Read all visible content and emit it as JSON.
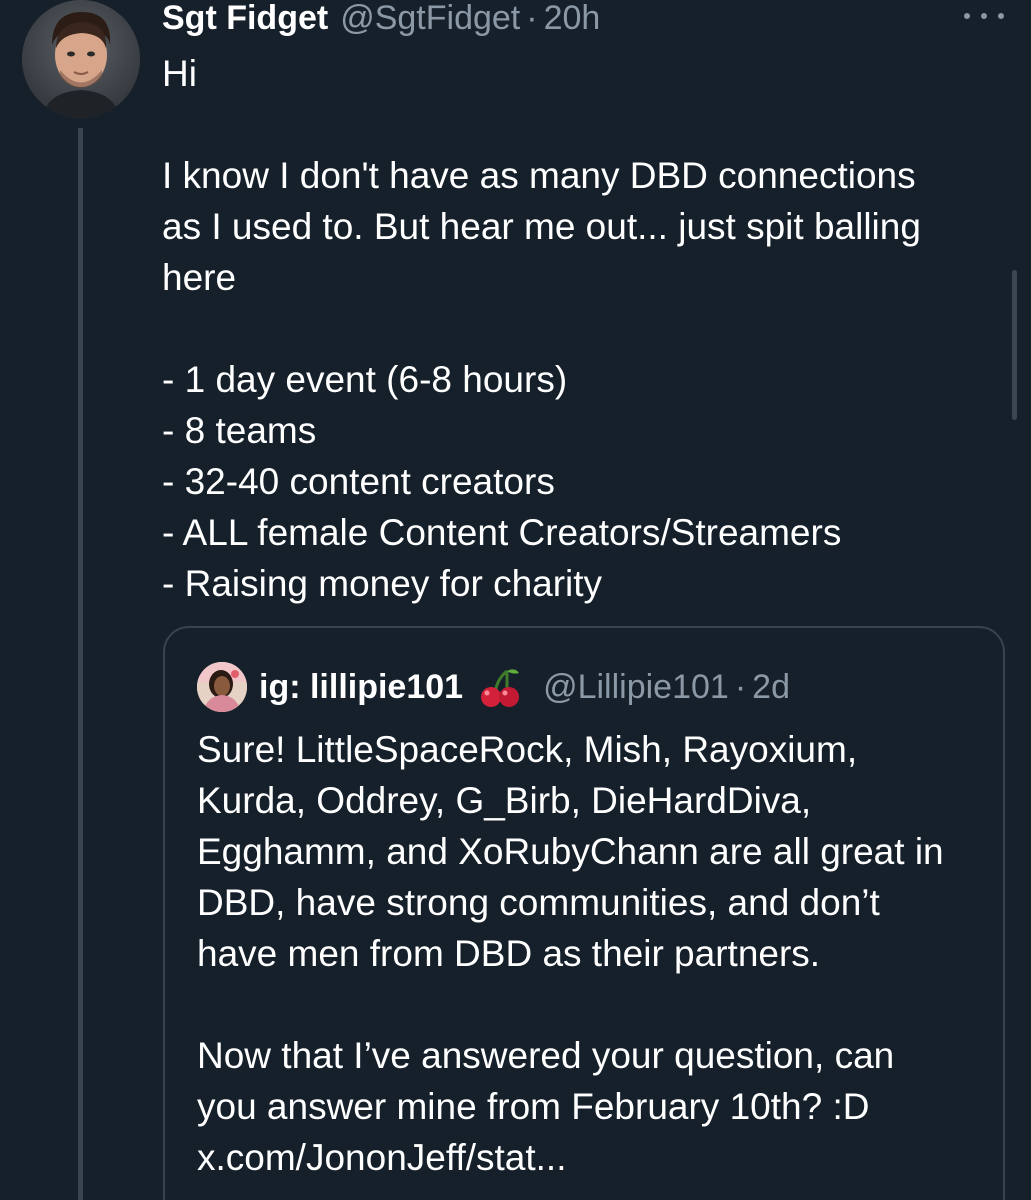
{
  "tweet": {
    "author_name": "Sgt Fidget",
    "author_handle": "@SgtFidget",
    "separator": "·",
    "time": "20h",
    "avatar_icon": "avatar-photo-icon",
    "more_icon": "more-options-icon",
    "body": {
      "line_greeting": "Hi",
      "intro_line_1": "I know I don't have as many DBD connections",
      "intro_line_2": "as I used to. But hear me out... just spit balling",
      "intro_line_3": "here",
      "bullets": [
        "- 1 day event (6-8 hours)",
        "- 8 teams",
        "- 32-40 content creators",
        "- ALL female Content Creators/Streamers",
        "- Raising money for charity"
      ]
    }
  },
  "quote": {
    "author_name": "ig: lillipie101",
    "emoji_icon": "cherry-icon",
    "author_handle": "@Lillipie101",
    "separator": "·",
    "time": "2d",
    "lines_1": [
      "Sure! LittleSpaceRock, Mish, Rayoxium,",
      "Kurda, Oddrey, G_Birb, DieHardDiva,",
      "Egghamm, and XoRubyChann are all great in",
      "DBD, have strong communities, and don’t",
      "have men from DBD as their partners."
    ],
    "lines_2": [
      "Now that I’ve answered your question, can",
      "you answer mine from February 10th? :D",
      "x.com/JononJeff/stat..."
    ]
  },
  "colors": {
    "background": "#15202b",
    "primary_text": "#ffffff",
    "secondary_text": "#8b98a5",
    "border": "#38444d"
  }
}
